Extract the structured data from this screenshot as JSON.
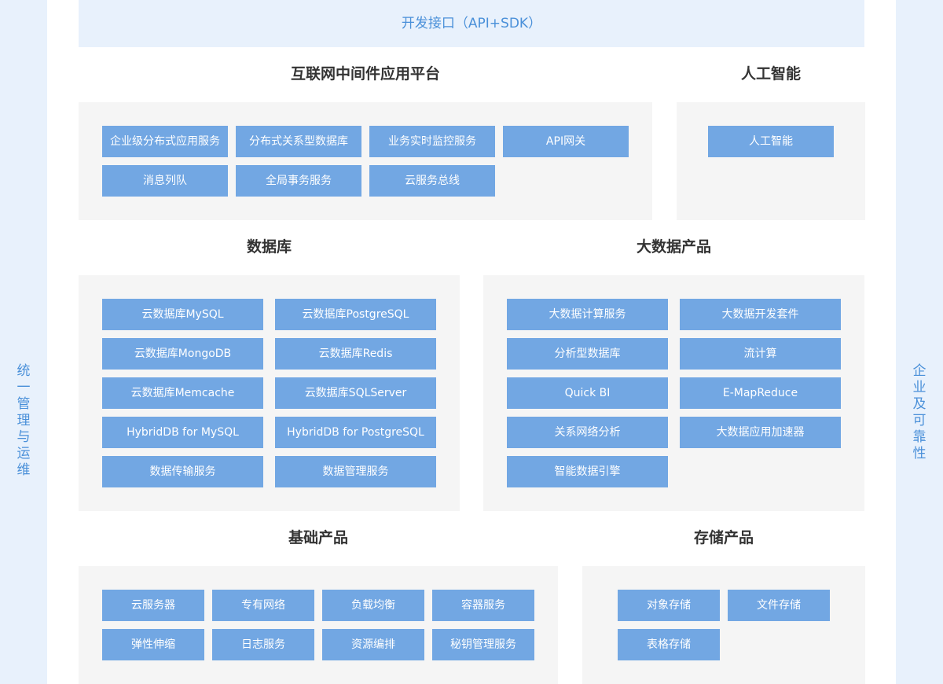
{
  "top_bar": "开发接口（API+SDK）",
  "left_side": [
    "统",
    "一",
    "管",
    "理",
    "与",
    "运",
    "维"
  ],
  "right_side": [
    "企",
    "业",
    "及",
    "可",
    "靠",
    "性"
  ],
  "sections": {
    "middleware": {
      "title": "互联网中间件应用平台",
      "items": [
        "企业级分布式应用服务",
        "分布式关系型数据库",
        "业务实时监控服务",
        "API网关",
        "消息列队",
        "全局事务服务",
        "云服务总线"
      ]
    },
    "ai": {
      "title": "人工智能",
      "items": [
        "人工智能"
      ]
    },
    "database": {
      "title": "数据库",
      "items": [
        "云数据库MySQL",
        "云数据库PostgreSQL",
        "云数据库MongoDB",
        "云数据库Redis",
        "云数据库Memcache",
        "云数据库SQLServer",
        "HybridDB for MySQL",
        "HybridDB for PostgreSQL",
        "数据传输服务",
        "数据管理服务"
      ]
    },
    "bigdata": {
      "title": "大数据产品",
      "items": [
        "大数据计算服务",
        "大数据开发套件",
        "分析型数据库",
        "流计算",
        "Quick BI",
        "E-MapReduce",
        "关系网络分析",
        "大数据应用加速器",
        "智能数据引擎"
      ]
    },
    "basic": {
      "title": "基础产品",
      "items": [
        "云服务器",
        "专有网络",
        "负载均衡",
        "容器服务",
        "弹性伸缩",
        "日志服务",
        "资源编排",
        "秘钥管理服务"
      ]
    },
    "storage": {
      "title": "存储产品",
      "items": [
        "对象存储",
        "文件存储",
        "表格存储"
      ]
    }
  }
}
